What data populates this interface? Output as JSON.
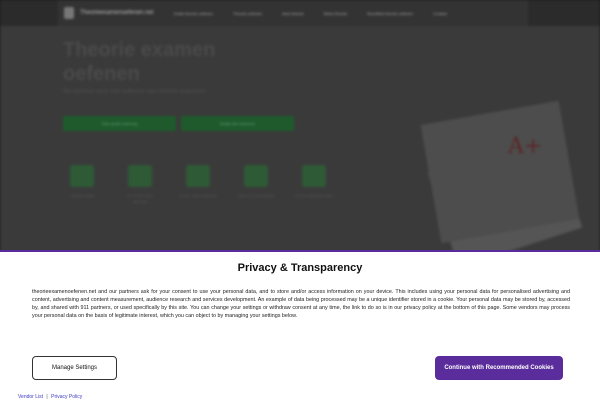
{
  "background": {
    "brand": "Theorieexamenoefenen.net",
    "nav_links": [
      "Gratis theorie oefenen",
      "Theorie oefenen",
      "Auto theorie",
      "Motor theorie",
      "Bromfiets theorie oefenen",
      "Contact"
    ],
    "hero_title": "Theorie examen oefenen",
    "hero_subtitle": "De website voor het oefenen van theorie examens",
    "buttons": [
      "Start gratis oefening",
      "Bekijk alle examens"
    ],
    "features": [
      "Volledig gratis",
      "Al 10.000 keer gebruikt",
      "Echte CBR examens",
      "Direct je beoordeling",
      "Snel je rijbewijs halen"
    ]
  },
  "modal": {
    "title": "Privacy & Transparency",
    "body": "theorieexamenoefenen.net and our partners ask for your consent to use your personal data, and to store and/or access information on your device. This includes using your personal data for personalised advertising and content, advertising and content measurement, audience research and services development. An example of data being processed may be a unique identifier stored in a cookie. Your personal data may be stored by, accessed by, and shared with 911 partners, or used specifically by this site. You can change your settings or withdraw consent at any time, the link to do so is in our privacy policy at the bottom of this page. Some vendors may process your personal data on the basis of legitimate interest, which you can object to by managing your settings below.",
    "manage_label": "Manage Settings",
    "accept_label": "Continue with Recommended Cookies",
    "vendor_link": "Vendor List",
    "separator": "|",
    "privacy_link": "Privacy Policy"
  },
  "colors": {
    "accent": "#5b2d9c",
    "overlay": "#1a1a1a",
    "link": "#3b3bc4"
  }
}
